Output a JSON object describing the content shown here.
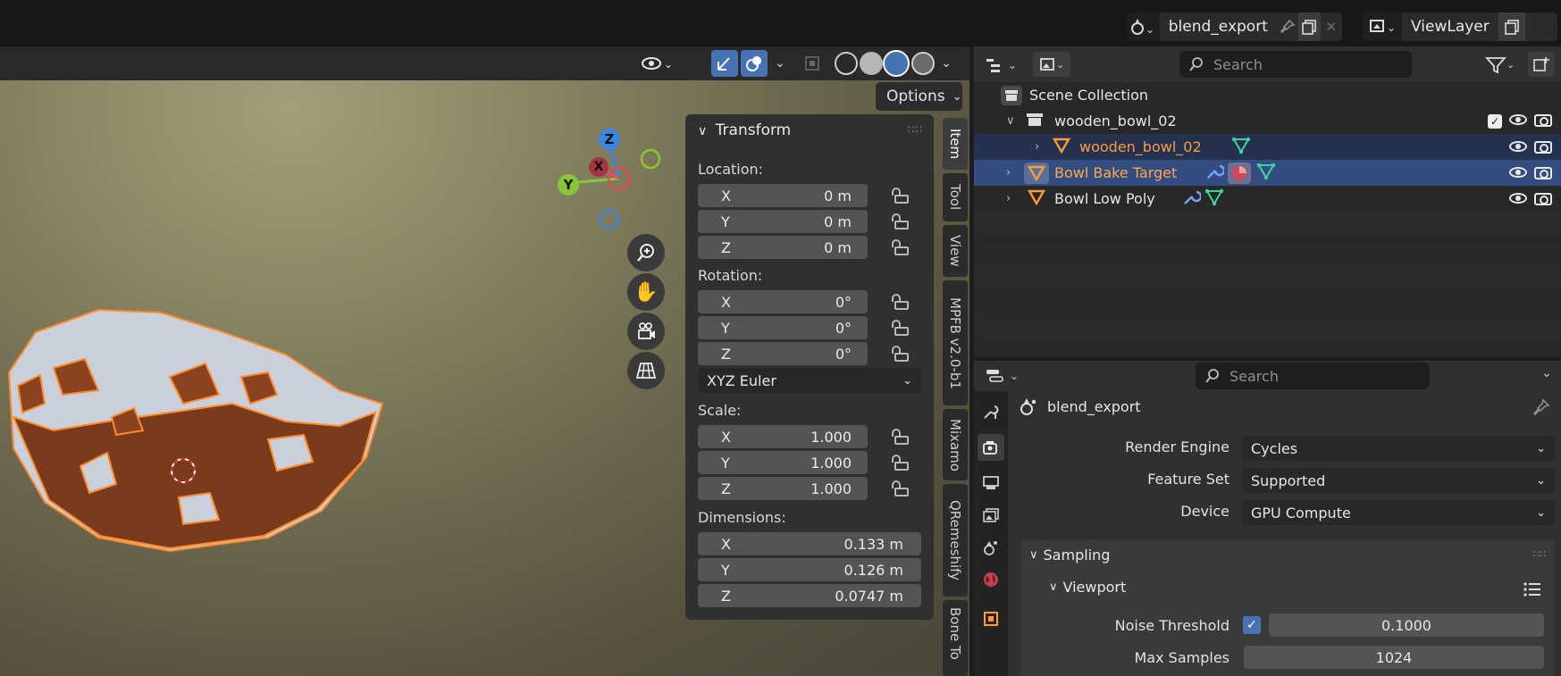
{
  "header": {
    "scene_name": "blend_export",
    "view_layer": "ViewLayer"
  },
  "viewport": {
    "options_label": "Options",
    "gizmo": {
      "z": "Z",
      "y": "Y",
      "x": "X"
    }
  },
  "transform": {
    "title": "Transform",
    "location_label": "Location:",
    "location": [
      {
        "axis": "X",
        "value": "0 m"
      },
      {
        "axis": "Y",
        "value": "0 m"
      },
      {
        "axis": "Z",
        "value": "0 m"
      }
    ],
    "rotation_label": "Rotation:",
    "rotation": [
      {
        "axis": "X",
        "value": "0°"
      },
      {
        "axis": "Y",
        "value": "0°"
      },
      {
        "axis": "Z",
        "value": "0°"
      }
    ],
    "rotation_mode": "XYZ Euler",
    "scale_label": "Scale:",
    "scale": [
      {
        "axis": "X",
        "value": "1.000"
      },
      {
        "axis": "Y",
        "value": "1.000"
      },
      {
        "axis": "Z",
        "value": "1.000"
      }
    ],
    "dimensions_label": "Dimensions:",
    "dimensions": [
      {
        "axis": "X",
        "value": "0.133 m"
      },
      {
        "axis": "Y",
        "value": "0.126 m"
      },
      {
        "axis": "Z",
        "value": "0.0747 m"
      }
    ]
  },
  "sidebar_tabs": [
    "Item",
    "Tool",
    "View",
    "MPFB v2.0-b1",
    "Mixamo",
    "QRemeshify",
    "Bone To"
  ],
  "outliner": {
    "search_placeholder": "Search",
    "scene_collection": "Scene Collection",
    "rows": [
      {
        "label": "wooden_bowl_02"
      },
      {
        "label": "wooden_bowl_02"
      },
      {
        "label": "Bowl Bake Target"
      },
      {
        "label": "Bowl Low Poly"
      }
    ]
  },
  "properties": {
    "search_placeholder": "Search",
    "scene_name": "blend_export",
    "render_engine_label": "Render Engine",
    "render_engine": "Cycles",
    "feature_set_label": "Feature Set",
    "feature_set": "Supported",
    "device_label": "Device",
    "device": "GPU Compute",
    "sampling_label": "Sampling",
    "viewport_label": "Viewport",
    "noise_threshold_label": "Noise Threshold",
    "noise_threshold": "0.1000",
    "max_samples_label": "Max Samples",
    "max_samples": "1024"
  },
  "colors": {
    "selection": "#334d80",
    "active_text": "#ff9a3c",
    "accent": "#4772b3",
    "axis_x": "#e04a5a",
    "axis_y": "#8ac43a",
    "axis_z": "#3a86e0"
  }
}
